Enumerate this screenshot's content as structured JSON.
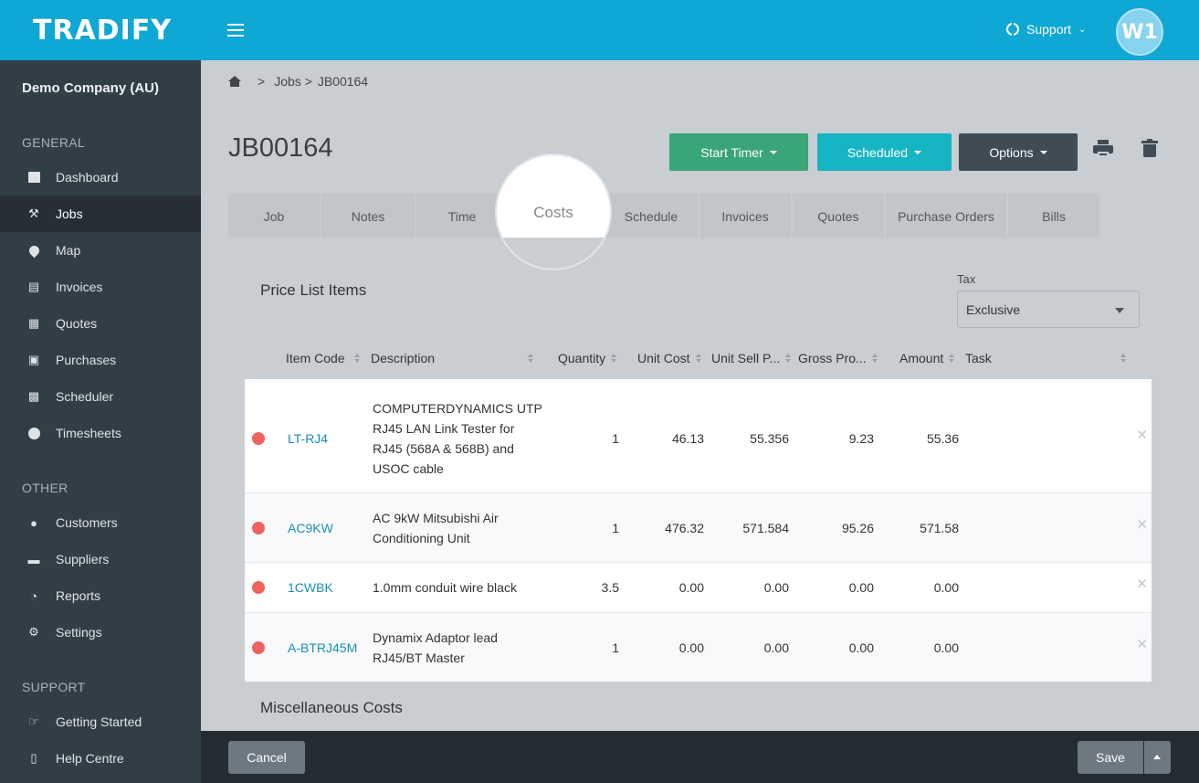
{
  "app": {
    "logo": "TRADIFY"
  },
  "header": {
    "support_label": "Support",
    "avatar_initials": "W1"
  },
  "sidebar": {
    "company": "Demo Company (AU)",
    "sections": [
      {
        "title": "GENERAL",
        "items": [
          {
            "label": "Dashboard",
            "icon": "dashboard-icon"
          },
          {
            "label": "Jobs",
            "icon": "hammer-icon",
            "active": true
          },
          {
            "label": "Map",
            "icon": "map-pin-icon"
          },
          {
            "label": "Invoices",
            "icon": "invoice-icon"
          },
          {
            "label": "Quotes",
            "icon": "calculator-icon"
          },
          {
            "label": "Purchases",
            "icon": "cart-icon"
          },
          {
            "label": "Scheduler",
            "icon": "calendar-icon"
          },
          {
            "label": "Timesheets",
            "icon": "clock-icon"
          }
        ]
      },
      {
        "title": "OTHER",
        "items": [
          {
            "label": "Customers",
            "icon": "users-icon"
          },
          {
            "label": "Suppliers",
            "icon": "truck-icon"
          },
          {
            "label": "Reports",
            "icon": "pie-chart-icon"
          },
          {
            "label": "Settings",
            "icon": "gear-icon"
          }
        ]
      },
      {
        "title": "SUPPORT",
        "items": [
          {
            "label": "Getting Started",
            "icon": "thumbs-up-icon"
          },
          {
            "label": "Help Centre",
            "icon": "book-icon"
          }
        ]
      }
    ]
  },
  "breadcrumb": {
    "sep": ">",
    "jobs": "Jobs >",
    "current": "JB00164"
  },
  "page": {
    "title": "JB00164"
  },
  "actions": {
    "start_timer": "Start Timer",
    "scheduled": "Scheduled",
    "options": "Options"
  },
  "tabs": [
    "Job",
    "Notes",
    "Time",
    "Costs",
    "Schedule",
    "Invoices",
    "Quotes",
    "Purchase Orders",
    "Bills"
  ],
  "active_tab": "Costs",
  "price_list": {
    "title": "Price List Items",
    "tax_label": "Tax",
    "tax_value": "Exclusive",
    "columns": [
      "Item Code",
      "Description",
      "Quantity",
      "Unit Cost",
      "Unit Sell P...",
      "Gross Pro...",
      "Amount",
      "Task"
    ],
    "rows": [
      {
        "code": "LT-RJ4",
        "desc": [
          "COMPUTERDYNAMICS UTP",
          "RJ45 LAN Link Tester for",
          "RJ45 (568A & 568B) and",
          "USOC cable"
        ],
        "qty": "1",
        "unit_cost": "46.13",
        "unit_sell": "55.356",
        "gross": "9.23",
        "amount": "55.36"
      },
      {
        "code": "AC9KW",
        "desc": [
          "AC 9kW Mitsubishi Air",
          "Conditioning Unit"
        ],
        "qty": "1",
        "unit_cost": "476.32",
        "unit_sell": "571.584",
        "gross": "95.26",
        "amount": "571.58"
      },
      {
        "code": "1CWBK",
        "desc": [
          "1.0mm conduit wire black"
        ],
        "qty": "3.5",
        "unit_cost": "0.00",
        "unit_sell": "0.00",
        "gross": "0.00",
        "amount": "0.00"
      },
      {
        "code": "A-BTRJ45M",
        "desc": [
          "Dynamix Adaptor lead",
          "RJ45/BT Master"
        ],
        "qty": "1",
        "unit_cost": "0.00",
        "unit_sell": "0.00",
        "gross": "0.00",
        "amount": "0.00"
      }
    ]
  },
  "misc": {
    "title": "Miscellaneous Costs"
  },
  "footer": {
    "cancel": "Cancel",
    "save": "Save"
  },
  "colors": {
    "topbar": "#0fa7d3",
    "sidebar": "#323e46",
    "timer": "#3aa577",
    "scheduled": "#17b5c3",
    "options": "#3f4b55",
    "status_dot": "#f0625f",
    "link": "#1a8fb5"
  }
}
